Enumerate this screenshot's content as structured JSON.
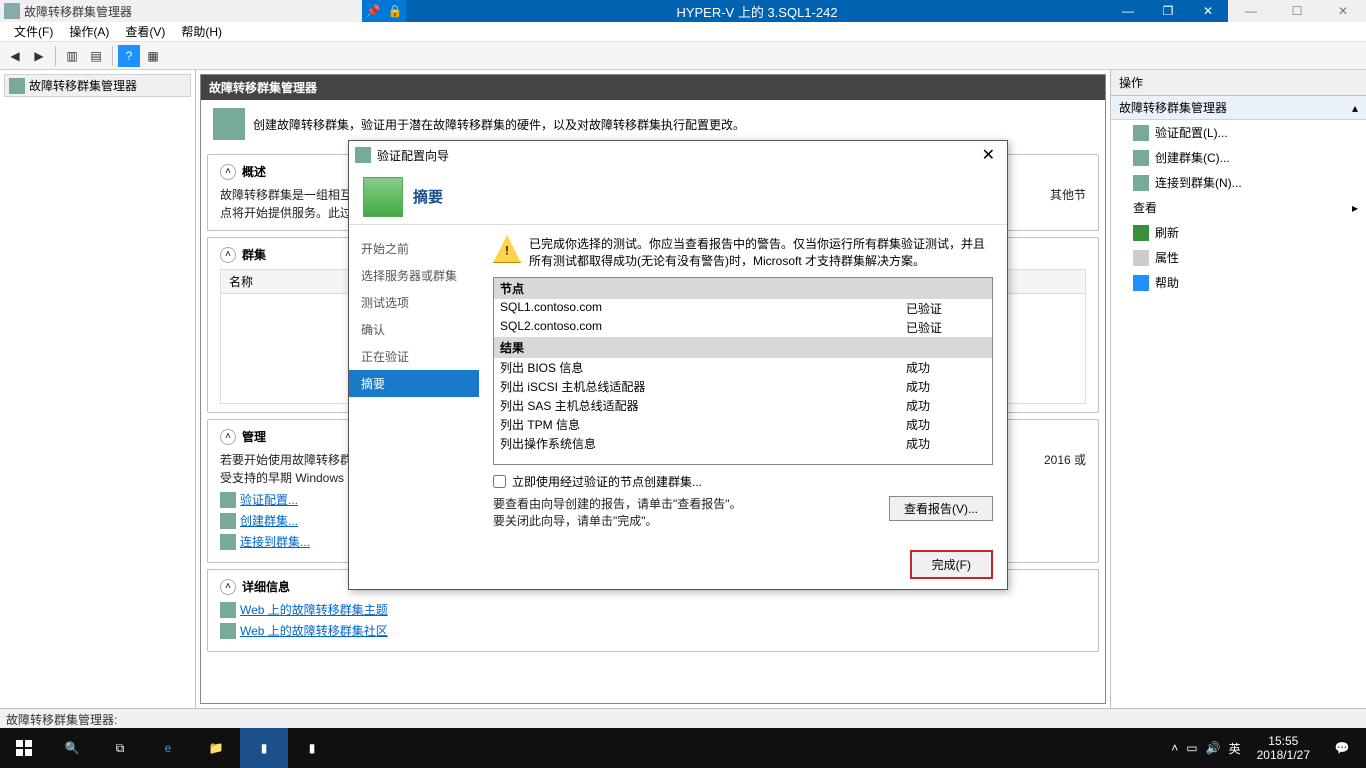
{
  "vm": {
    "app_title": "故障转移群集管理器",
    "caption": "HYPER-V 上的 3.SQL1-242"
  },
  "menu": {
    "file": "文件(F)",
    "action": "操作(A)",
    "view": "查看(V)",
    "help": "帮助(H)"
  },
  "tree": {
    "root": "故障转移群集管理器"
  },
  "center": {
    "header": "故障转移群集管理器",
    "intro": "创建故障转移群集，验证用于潜在故障转移群集的硬件，以及对故障转移群集执行配置更改。",
    "overview_title": "概述",
    "overview_text1": "故障转移群集是一组相互…",
    "overview_text2": "点将开始提供服务。此过…",
    "overview_trail": "其他节",
    "clusters_title": "群集",
    "clusters_col": "名称",
    "manage_title": "管理",
    "manage_text1": "若要开始使用故障转移群集…",
    "manage_text2": "受支持的早期 Windows S…",
    "manage_trail": "2016 或",
    "link_validate": "验证配置...",
    "link_create": "创建群集...",
    "link_connect": "连接到群集...",
    "details_title": "详细信息",
    "link_web1": "Web 上的故障转移群集主题",
    "link_web2": "Web 上的故障转移群集社区"
  },
  "actions": {
    "title": "操作",
    "group": "故障转移群集管理器",
    "validate": "验证配置(L)...",
    "create": "创建群集(C)...",
    "connect": "连接到群集(N)...",
    "view": "查看",
    "refresh": "刷新",
    "properties": "属性",
    "help": "帮助"
  },
  "wizard": {
    "title": "验证配置向导",
    "banner": "摘要",
    "nav": {
      "before": "开始之前",
      "select": "选择服务器或群集",
      "options": "测试选项",
      "confirm": "确认",
      "validating": "正在验证",
      "summary": "摘要"
    },
    "warn": "已完成你选择的测试。你应当查看报告中的警告。仅当你运行所有群集验证测试，并且所有测试都取得成功(无论有没有警告)时，Microsoft 才支持群集解决方案。",
    "nodes_hdr": "节点",
    "nodes": [
      {
        "name": "SQL1.contoso.com",
        "status": "已验证"
      },
      {
        "name": "SQL2.contoso.com",
        "status": "已验证"
      }
    ],
    "results_hdr": "结果",
    "results": [
      {
        "name": "列出 BIOS 信息",
        "status": "成功"
      },
      {
        "name": "列出 iSCSI 主机总线适配器",
        "status": "成功"
      },
      {
        "name": "列出 SAS 主机总线适配器",
        "status": "成功"
      },
      {
        "name": "列出 TPM 信息",
        "status": "成功"
      },
      {
        "name": "列出操作系统信息",
        "status": "成功"
      }
    ],
    "checkbox": "立即使用经过验证的节点创建群集...",
    "note1": "要查看由向导创建的报告，请单击\"查看报告\"。",
    "note2": "要关闭此向导，请单击\"完成\"。",
    "view_report": "查看报告(V)...",
    "finish": "完成(F)"
  },
  "status": "故障转移群集管理器:",
  "taskbar": {
    "time": "15:55",
    "date": "2018/1/27",
    "ime": "英"
  }
}
